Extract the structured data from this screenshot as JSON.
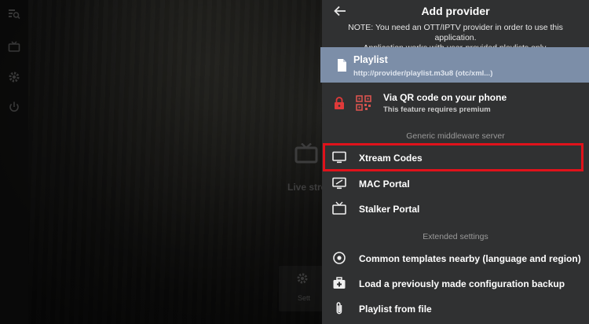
{
  "dialog": {
    "title": "Add provider",
    "note_line1": "NOTE: You need an OTT/IPTV provider in order to use this application.",
    "note_line2": "Application works with user-provided playlists only."
  },
  "background": {
    "live_label": "Live stre",
    "card_label": "Sett"
  },
  "items": {
    "playlist": {
      "label": "Playlist",
      "sub": "http://provider/playlist.m3u8 (otc/xml...)"
    },
    "qr": {
      "label": "Via QR code on your phone",
      "sub": "This feature requires premium"
    },
    "xtream": {
      "label": "Xtream Codes"
    },
    "mac": {
      "label": "MAC Portal"
    },
    "stalker": {
      "label": "Stalker Portal"
    },
    "templates": {
      "label": "Common templates nearby (language and region)"
    },
    "backup": {
      "label": "Load a previously made configuration backup"
    },
    "file": {
      "label": "Playlist from file"
    }
  },
  "sections": {
    "middleware": "Generic middleware server",
    "extended": "Extended settings"
  },
  "colors": {
    "panel_bg": "#303132",
    "selected_bg": "#7c8ea8",
    "highlight": "#e0121b"
  }
}
